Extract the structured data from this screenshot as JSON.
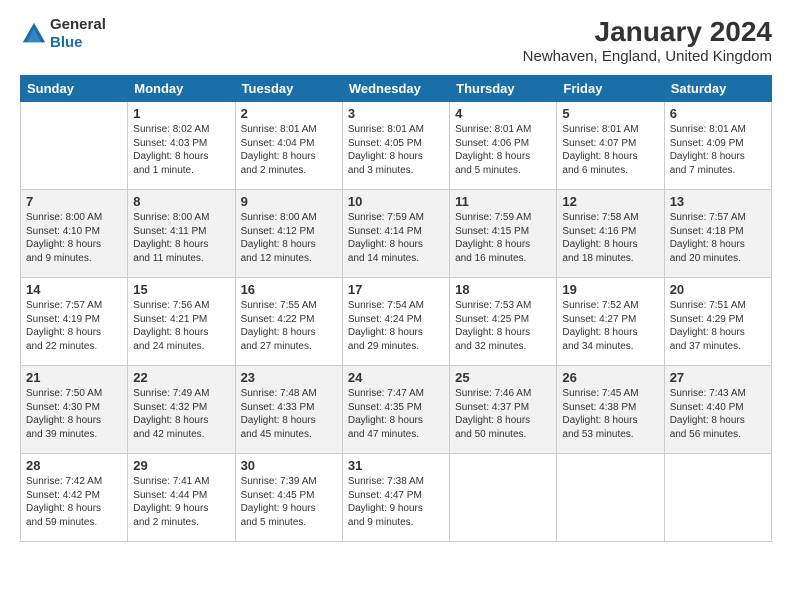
{
  "header": {
    "logo_general": "General",
    "logo_blue": "Blue",
    "main_title": "January 2024",
    "subtitle": "Newhaven, England, United Kingdom"
  },
  "columns": [
    "Sunday",
    "Monday",
    "Tuesday",
    "Wednesday",
    "Thursday",
    "Friday",
    "Saturday"
  ],
  "weeks": [
    [
      {
        "day": "",
        "info": ""
      },
      {
        "day": "1",
        "info": "Sunrise: 8:02 AM\nSunset: 4:03 PM\nDaylight: 8 hours\nand 1 minute."
      },
      {
        "day": "2",
        "info": "Sunrise: 8:01 AM\nSunset: 4:04 PM\nDaylight: 8 hours\nand 2 minutes."
      },
      {
        "day": "3",
        "info": "Sunrise: 8:01 AM\nSunset: 4:05 PM\nDaylight: 8 hours\nand 3 minutes."
      },
      {
        "day": "4",
        "info": "Sunrise: 8:01 AM\nSunset: 4:06 PM\nDaylight: 8 hours\nand 5 minutes."
      },
      {
        "day": "5",
        "info": "Sunrise: 8:01 AM\nSunset: 4:07 PM\nDaylight: 8 hours\nand 6 minutes."
      },
      {
        "day": "6",
        "info": "Sunrise: 8:01 AM\nSunset: 4:09 PM\nDaylight: 8 hours\nand 7 minutes."
      }
    ],
    [
      {
        "day": "7",
        "info": "Sunrise: 8:00 AM\nSunset: 4:10 PM\nDaylight: 8 hours\nand 9 minutes."
      },
      {
        "day": "8",
        "info": "Sunrise: 8:00 AM\nSunset: 4:11 PM\nDaylight: 8 hours\nand 11 minutes."
      },
      {
        "day": "9",
        "info": "Sunrise: 8:00 AM\nSunset: 4:12 PM\nDaylight: 8 hours\nand 12 minutes."
      },
      {
        "day": "10",
        "info": "Sunrise: 7:59 AM\nSunset: 4:14 PM\nDaylight: 8 hours\nand 14 minutes."
      },
      {
        "day": "11",
        "info": "Sunrise: 7:59 AM\nSunset: 4:15 PM\nDaylight: 8 hours\nand 16 minutes."
      },
      {
        "day": "12",
        "info": "Sunrise: 7:58 AM\nSunset: 4:16 PM\nDaylight: 8 hours\nand 18 minutes."
      },
      {
        "day": "13",
        "info": "Sunrise: 7:57 AM\nSunset: 4:18 PM\nDaylight: 8 hours\nand 20 minutes."
      }
    ],
    [
      {
        "day": "14",
        "info": "Sunrise: 7:57 AM\nSunset: 4:19 PM\nDaylight: 8 hours\nand 22 minutes."
      },
      {
        "day": "15",
        "info": "Sunrise: 7:56 AM\nSunset: 4:21 PM\nDaylight: 8 hours\nand 24 minutes."
      },
      {
        "day": "16",
        "info": "Sunrise: 7:55 AM\nSunset: 4:22 PM\nDaylight: 8 hours\nand 27 minutes."
      },
      {
        "day": "17",
        "info": "Sunrise: 7:54 AM\nSunset: 4:24 PM\nDaylight: 8 hours\nand 29 minutes."
      },
      {
        "day": "18",
        "info": "Sunrise: 7:53 AM\nSunset: 4:25 PM\nDaylight: 8 hours\nand 32 minutes."
      },
      {
        "day": "19",
        "info": "Sunrise: 7:52 AM\nSunset: 4:27 PM\nDaylight: 8 hours\nand 34 minutes."
      },
      {
        "day": "20",
        "info": "Sunrise: 7:51 AM\nSunset: 4:29 PM\nDaylight: 8 hours\nand 37 minutes."
      }
    ],
    [
      {
        "day": "21",
        "info": "Sunrise: 7:50 AM\nSunset: 4:30 PM\nDaylight: 8 hours\nand 39 minutes."
      },
      {
        "day": "22",
        "info": "Sunrise: 7:49 AM\nSunset: 4:32 PM\nDaylight: 8 hours\nand 42 minutes."
      },
      {
        "day": "23",
        "info": "Sunrise: 7:48 AM\nSunset: 4:33 PM\nDaylight: 8 hours\nand 45 minutes."
      },
      {
        "day": "24",
        "info": "Sunrise: 7:47 AM\nSunset: 4:35 PM\nDaylight: 8 hours\nand 47 minutes."
      },
      {
        "day": "25",
        "info": "Sunrise: 7:46 AM\nSunset: 4:37 PM\nDaylight: 8 hours\nand 50 minutes."
      },
      {
        "day": "26",
        "info": "Sunrise: 7:45 AM\nSunset: 4:38 PM\nDaylight: 8 hours\nand 53 minutes."
      },
      {
        "day": "27",
        "info": "Sunrise: 7:43 AM\nSunset: 4:40 PM\nDaylight: 8 hours\nand 56 minutes."
      }
    ],
    [
      {
        "day": "28",
        "info": "Sunrise: 7:42 AM\nSunset: 4:42 PM\nDaylight: 8 hours\nand 59 minutes."
      },
      {
        "day": "29",
        "info": "Sunrise: 7:41 AM\nSunset: 4:44 PM\nDaylight: 9 hours\nand 2 minutes."
      },
      {
        "day": "30",
        "info": "Sunrise: 7:39 AM\nSunset: 4:45 PM\nDaylight: 9 hours\nand 5 minutes."
      },
      {
        "day": "31",
        "info": "Sunrise: 7:38 AM\nSunset: 4:47 PM\nDaylight: 9 hours\nand 9 minutes."
      },
      {
        "day": "",
        "info": ""
      },
      {
        "day": "",
        "info": ""
      },
      {
        "day": "",
        "info": ""
      }
    ]
  ]
}
